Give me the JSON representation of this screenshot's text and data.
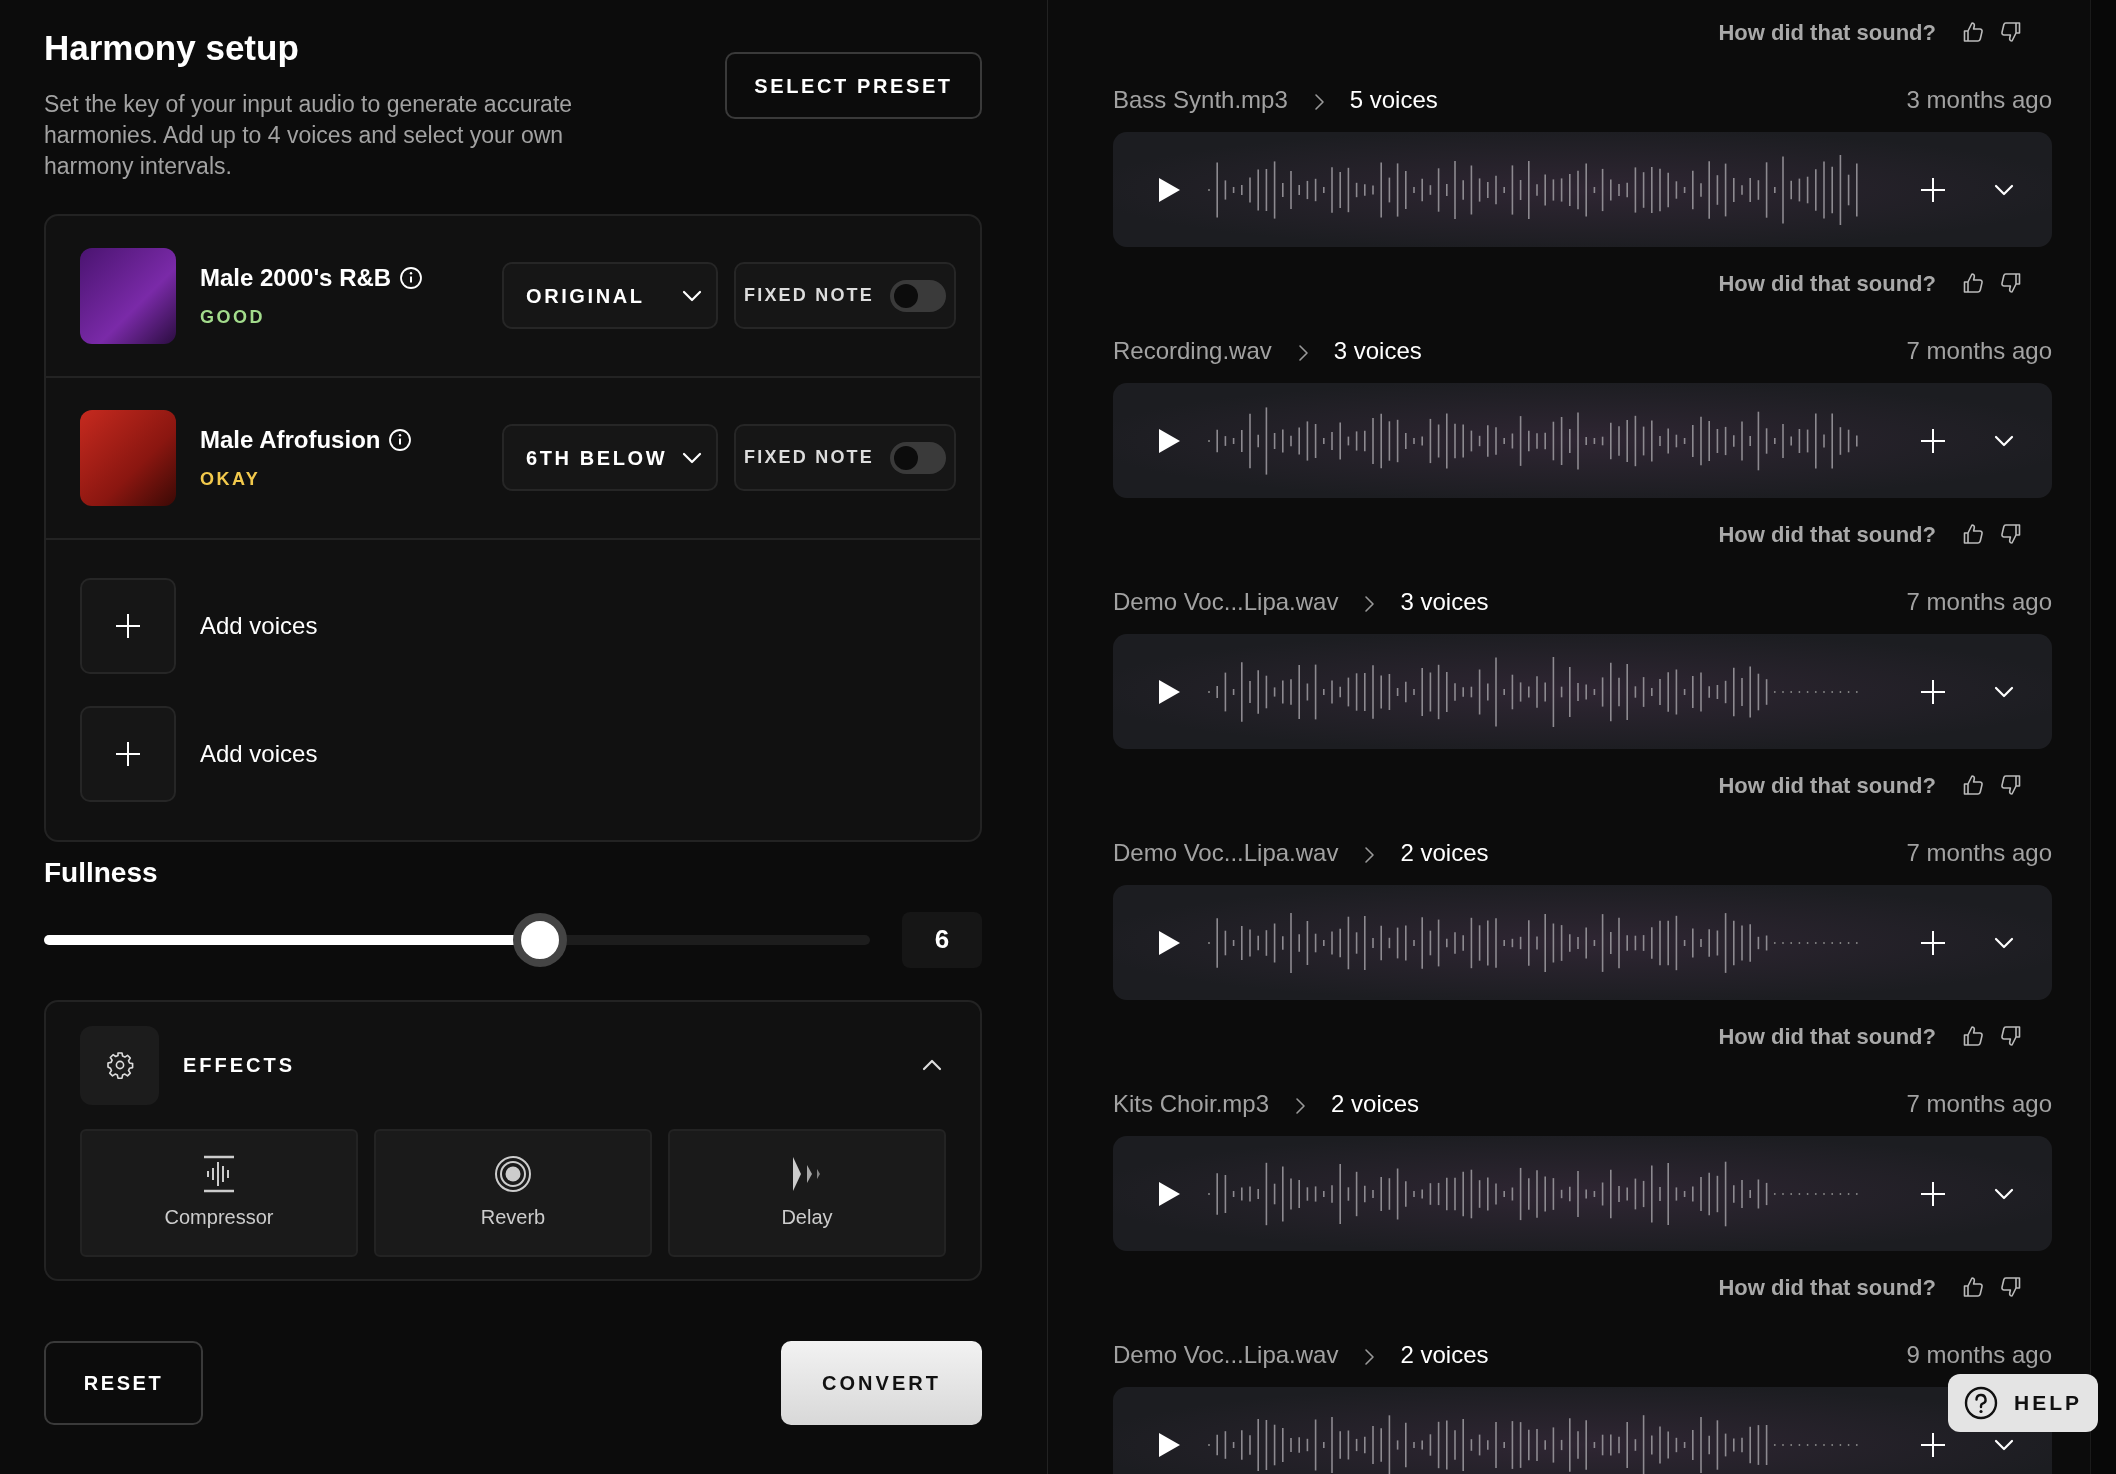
{
  "setup": {
    "title": "Harmony setup",
    "description": "Set the key of your input audio to generate accurate harmonies. Add up to 4 voices and select your own harmony intervals.",
    "preset_button": "SELECT PRESET",
    "voices": [
      {
        "name": "Male 2000's R&B",
        "quality": "GOOD",
        "color": "#a3dc8c",
        "interval": "ORIGINAL",
        "fixed_note_label": "FIXED NOTE",
        "fixed_note_on": false
      },
      {
        "name": "Male Afrofusion",
        "quality": "OKAY",
        "color": "#f2c94c",
        "interval": "6TH BELOW",
        "fixed_note_label": "FIXED NOTE",
        "fixed_note_on": false
      }
    ],
    "add_voice_slots": [
      {
        "label": "Add voices"
      },
      {
        "label": "Add voices"
      }
    ],
    "fullness": {
      "label": "Fullness",
      "level": 0.6,
      "reading": "6"
    },
    "effects": {
      "label": "EFFECTS",
      "expanded": true,
      "items": [
        {
          "kind": "compressor",
          "label": "Compressor"
        },
        {
          "kind": "reverb",
          "label": "Reverb"
        },
        {
          "kind": "delay",
          "label": "Delay"
        }
      ]
    },
    "reset_button": "RESET",
    "convert_button": "CONVERT"
  },
  "history": [
    {
      "feedback": "How did that sound?",
      "file": "Bass Synth.mp3",
      "voices": "5 voices",
      "time": "3 months ago"
    },
    {
      "feedback": "How did that sound?",
      "file": "Recording.wav",
      "voices": "3 voices",
      "time": "7 months ago"
    },
    {
      "feedback": "How did that sound?",
      "file": "Demo Voc...Lipa.wav",
      "voices": "3 voices",
      "time": "7 months ago"
    },
    {
      "feedback": "How did that sound?",
      "file": "Demo Voc...Lipa.wav",
      "voices": "2 voices",
      "time": "7 months ago"
    },
    {
      "feedback": "How did that sound?",
      "file": "Kits Choir.mp3",
      "voices": "2 voices",
      "time": "7 months ago"
    },
    {
      "feedback": "How did that sound?",
      "file": "Demo Voc...Lipa.wav",
      "voices": "2 voices",
      "time": "9 months ago"
    }
  ],
  "help_button": "HELP"
}
